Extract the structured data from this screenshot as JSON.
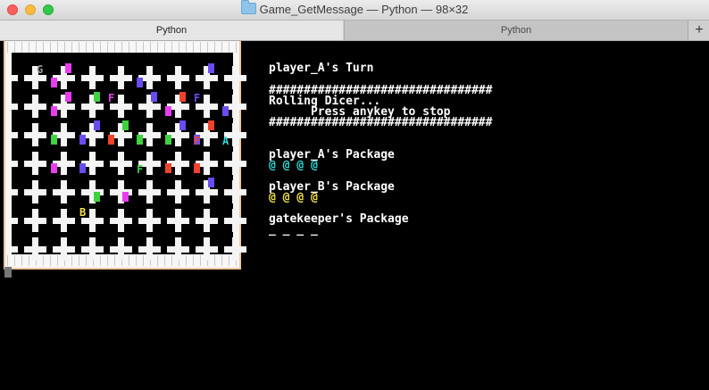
{
  "window": {
    "title": "Game_GetMessage — Python — 98×32",
    "controls": [
      "close",
      "minimize",
      "zoom"
    ]
  },
  "tabs": [
    {
      "label": "Python",
      "active": true
    },
    {
      "label": "Python",
      "active": false
    }
  ],
  "new_tab_label": "+",
  "terminal": {
    "turn_line": "player_A's Turn",
    "hash_line": "################################",
    "rolling": "Rolling Dicer...",
    "press": "      Press anykey to stop",
    "a_package_label": "player_A's Package",
    "a_package_items": "@ @ @ @",
    "b_package_label": "player_B's Package",
    "b_package_items": "@ @ @ @",
    "gk_package_label": "gatekeeper's Package",
    "gk_package_items": "_ _ _ _"
  },
  "colors": {
    "a_items": "#33d6d6",
    "b_items": "#f2e24a",
    "magenta": "#ea3df0",
    "blue": "#6a4cf2",
    "green": "#3fd23f",
    "red": "#f0432a",
    "board_white": "#f4f4f4",
    "board_border": "#f6c79e"
  },
  "board": {
    "labels": [
      {
        "ch": "G",
        "c": 2,
        "r": 1,
        "color": "#9a9a9a"
      },
      {
        "ch": "F",
        "c": 7,
        "r": 3,
        "color": "#ea3df0"
      },
      {
        "ch": "F",
        "c": 13,
        "r": 3,
        "color": "#6a4cf2"
      },
      {
        "ch": "F",
        "c": 13,
        "r": 6,
        "color": "#f0432a"
      },
      {
        "ch": "A",
        "c": 15,
        "r": 6,
        "color": "#33d6d6"
      },
      {
        "ch": "F",
        "c": 9,
        "r": 8,
        "color": "#3fd23f"
      },
      {
        "ch": "B",
        "c": 5,
        "r": 11,
        "color": "#f2e24a"
      }
    ],
    "markers": [
      {
        "c": 4,
        "r": 1,
        "color": "#ea3df0"
      },
      {
        "c": 14,
        "r": 1,
        "color": "#6a4cf2"
      },
      {
        "c": 3,
        "r": 2,
        "color": "#ea3df0"
      },
      {
        "c": 9,
        "r": 2,
        "color": "#6a4cf2"
      },
      {
        "c": 4,
        "r": 3,
        "color": "#ea3df0"
      },
      {
        "c": 6,
        "r": 3,
        "color": "#3fd23f"
      },
      {
        "c": 10,
        "r": 3,
        "color": "#6a4cf2"
      },
      {
        "c": 12,
        "r": 3,
        "color": "#f0432a"
      },
      {
        "c": 3,
        "r": 4,
        "color": "#ea3df0"
      },
      {
        "c": 11,
        "r": 4,
        "color": "#ea3df0"
      },
      {
        "c": 15,
        "r": 4,
        "color": "#6a4cf2"
      },
      {
        "c": 6,
        "r": 5,
        "color": "#6a4cf2"
      },
      {
        "c": 8,
        "r": 5,
        "color": "#3fd23f"
      },
      {
        "c": 12,
        "r": 5,
        "color": "#6a4cf2"
      },
      {
        "c": 14,
        "r": 5,
        "color": "#f0432a"
      },
      {
        "c": 3,
        "r": 6,
        "color": "#3fd23f"
      },
      {
        "c": 5,
        "r": 6,
        "color": "#6a4cf2"
      },
      {
        "c": 7,
        "r": 6,
        "color": "#f0432a"
      },
      {
        "c": 9,
        "r": 6,
        "color": "#3fd23f"
      },
      {
        "c": 11,
        "r": 6,
        "color": "#3fd23f"
      },
      {
        "c": 13,
        "r": 6,
        "color": "#6a4cf2"
      },
      {
        "c": 3,
        "r": 8,
        "color": "#ea3df0"
      },
      {
        "c": 5,
        "r": 8,
        "color": "#6a4cf2"
      },
      {
        "c": 11,
        "r": 8,
        "color": "#f0432a"
      },
      {
        "c": 13,
        "r": 8,
        "color": "#f0432a"
      },
      {
        "c": 14,
        "r": 9,
        "color": "#6a4cf2"
      },
      {
        "c": 6,
        "r": 10,
        "color": "#3fd23f"
      },
      {
        "c": 8,
        "r": 10,
        "color": "#ea3df0"
      }
    ]
  }
}
